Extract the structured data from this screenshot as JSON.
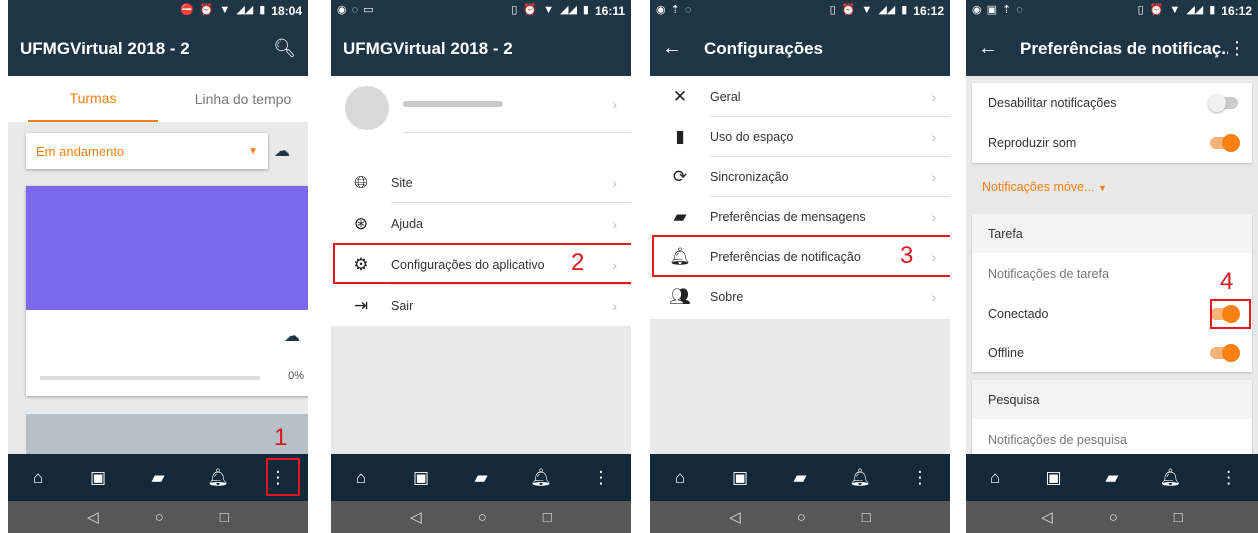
{
  "phones": [
    {
      "status": {
        "time": "18:04"
      },
      "appbar": {
        "title": "UFMGVirtual 2018 - 2"
      },
      "tabs": [
        {
          "label": "Turmas"
        },
        {
          "label": "Linha do tempo"
        }
      ],
      "filter": {
        "value": "Em andamento"
      },
      "course": {
        "progress": 0,
        "progress_label": "0%"
      },
      "marker_label": "1"
    },
    {
      "status": {
        "time": "16:11"
      },
      "appbar": {
        "title": "UFMGVirtual 2018 - 2"
      },
      "menu": [
        {
          "label": "Site",
          "icon": "globe-icon"
        },
        {
          "label": "Ajuda",
          "icon": "help-icon"
        },
        {
          "label": "Configurações do aplicativo",
          "icon": "gear-icon"
        },
        {
          "label": "Sair",
          "icon": "logout-icon"
        }
      ],
      "marker_label": "2"
    },
    {
      "status": {
        "time": "16:12"
      },
      "appbar": {
        "title": "Configurações"
      },
      "menu": [
        {
          "label": "Geral",
          "icon": "tools-icon"
        },
        {
          "label": "Uso do espaço",
          "icon": "bar-chart-icon"
        },
        {
          "label": "Sincronização",
          "icon": "sync-icon"
        },
        {
          "label": "Preferências de mensagens",
          "icon": "chat-icon"
        },
        {
          "label": "Preferências de notificação",
          "icon": "bell-icon"
        },
        {
          "label": "Sobre",
          "icon": "users-icon"
        }
      ],
      "marker_label": "3"
    },
    {
      "status": {
        "time": "16:12"
      },
      "appbar": {
        "title": "Preferências de notificaç..."
      },
      "general": [
        {
          "label": "Desabilitar notificações",
          "on": false
        },
        {
          "label": "Reproduzir som",
          "on": true
        }
      ],
      "dropdown": {
        "value": "Notificações móve..."
      },
      "tarefa": {
        "header": "Tarefa",
        "subheader": "Notificações de tarefa",
        "rows": [
          {
            "label": "Conectado",
            "on": true
          },
          {
            "label": "Offline",
            "on": true
          }
        ]
      },
      "pesquisa": {
        "header": "Pesquisa",
        "subheader": "Notificações de pesquisa"
      },
      "marker_label": "4"
    }
  ],
  "colors": {
    "appbar": "#1d3545",
    "accent": "#f98012",
    "marker": "#e0171f",
    "course_banner": "#7b68ef"
  }
}
